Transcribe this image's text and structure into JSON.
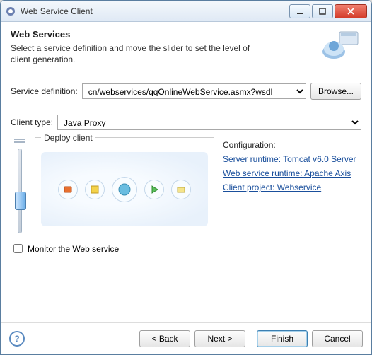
{
  "window": {
    "title": "Web Service Client"
  },
  "header": {
    "title": "Web Services",
    "subtitle": "Select a service definition and move the slider to set the level of client generation."
  },
  "serviceDef": {
    "label": "Service definition:",
    "value": "cn/webservices/qqOnlineWebService.asmx?wsdl",
    "browse": "Browse..."
  },
  "clientType": {
    "label": "Client type:",
    "value": "Java Proxy"
  },
  "deploy": {
    "legend": "Deploy client"
  },
  "config": {
    "title": "Configuration:",
    "server": "Server runtime: Tomcat v6.0 Server",
    "runtime": "Web service runtime: Apache Axis",
    "project": "Client project: Webservice"
  },
  "monitor": {
    "label": "Monitor the Web service",
    "checked": false
  },
  "footer": {
    "back": "< Back",
    "next": "Next >",
    "finish": "Finish",
    "cancel": "Cancel"
  }
}
